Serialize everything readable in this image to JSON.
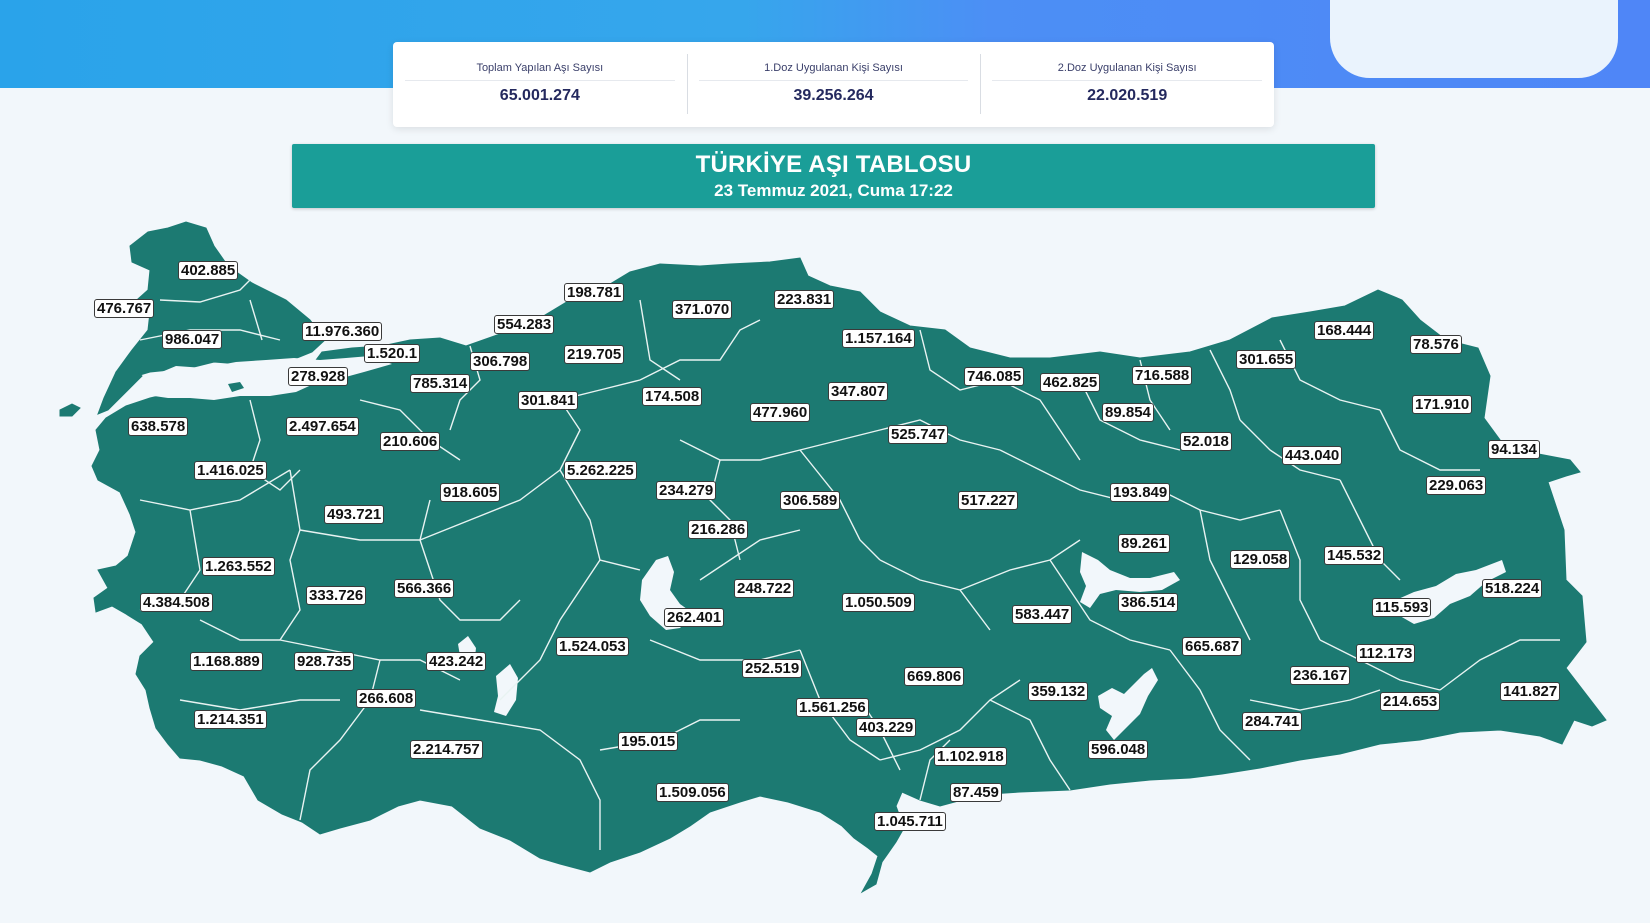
{
  "stats": [
    {
      "label": "Toplam Yapılan Aşı Sayısı",
      "value": "65.001.274"
    },
    {
      "label": "1.Doz Uygulanan Kişi Sayısı",
      "value": "39.256.264"
    },
    {
      "label": "2.Doz Uygulanan Kişi Sayısı",
      "value": "22.020.519"
    }
  ],
  "title": {
    "main": "TÜRKİYE AŞI TABLOSU",
    "date": "23 Temmuz 2021, Cuma 17:22"
  },
  "colors": {
    "land": "#1c7a72",
    "water": "#f2f7fb",
    "title_bg": "#1a9e98",
    "banner": "#2aa3ea"
  },
  "labels": [
    "402.885",
    "476.767",
    "986.047",
    "11.976.360",
    "554.283",
    "198.781",
    "371.070",
    "223.831",
    "1.520.1",
    "306.798",
    "219.705",
    "1.157.164",
    "278.928",
    "785.314",
    "301.841",
    "174.508",
    "347.807",
    "746.085",
    "462.825",
    "716.588",
    "301.655",
    "168.444",
    "78.576",
    "477.960",
    "89.854",
    "171.910",
    "638.578",
    "2.497.654",
    "210.606",
    "525.747",
    "52.018",
    "443.040",
    "94.134",
    "1.416.025",
    "5.262.225",
    "234.279",
    "229.063",
    "918.605",
    "306.589",
    "517.227",
    "193.849",
    "493.721",
    "216.286",
    "89.261",
    "129.058",
    "145.532",
    "1.263.552",
    "248.722",
    "518.224",
    "333.726",
    "566.366",
    "1.050.509",
    "386.514",
    "4.384.508",
    "262.401",
    "583.447",
    "115.593",
    "1.524.053",
    "665.687",
    "1.168.889",
    "928.735",
    "423.242",
    "112.173",
    "252.519",
    "669.806",
    "236.167",
    "359.132",
    "266.608",
    "141.827",
    "1.561.256",
    "214.653",
    "1.214.351",
    "403.229",
    "284.741",
    "195.015",
    "2.214.757",
    "596.048",
    "1.102.918",
    "1.509.056",
    "87.459",
    "1.045.711"
  ]
}
